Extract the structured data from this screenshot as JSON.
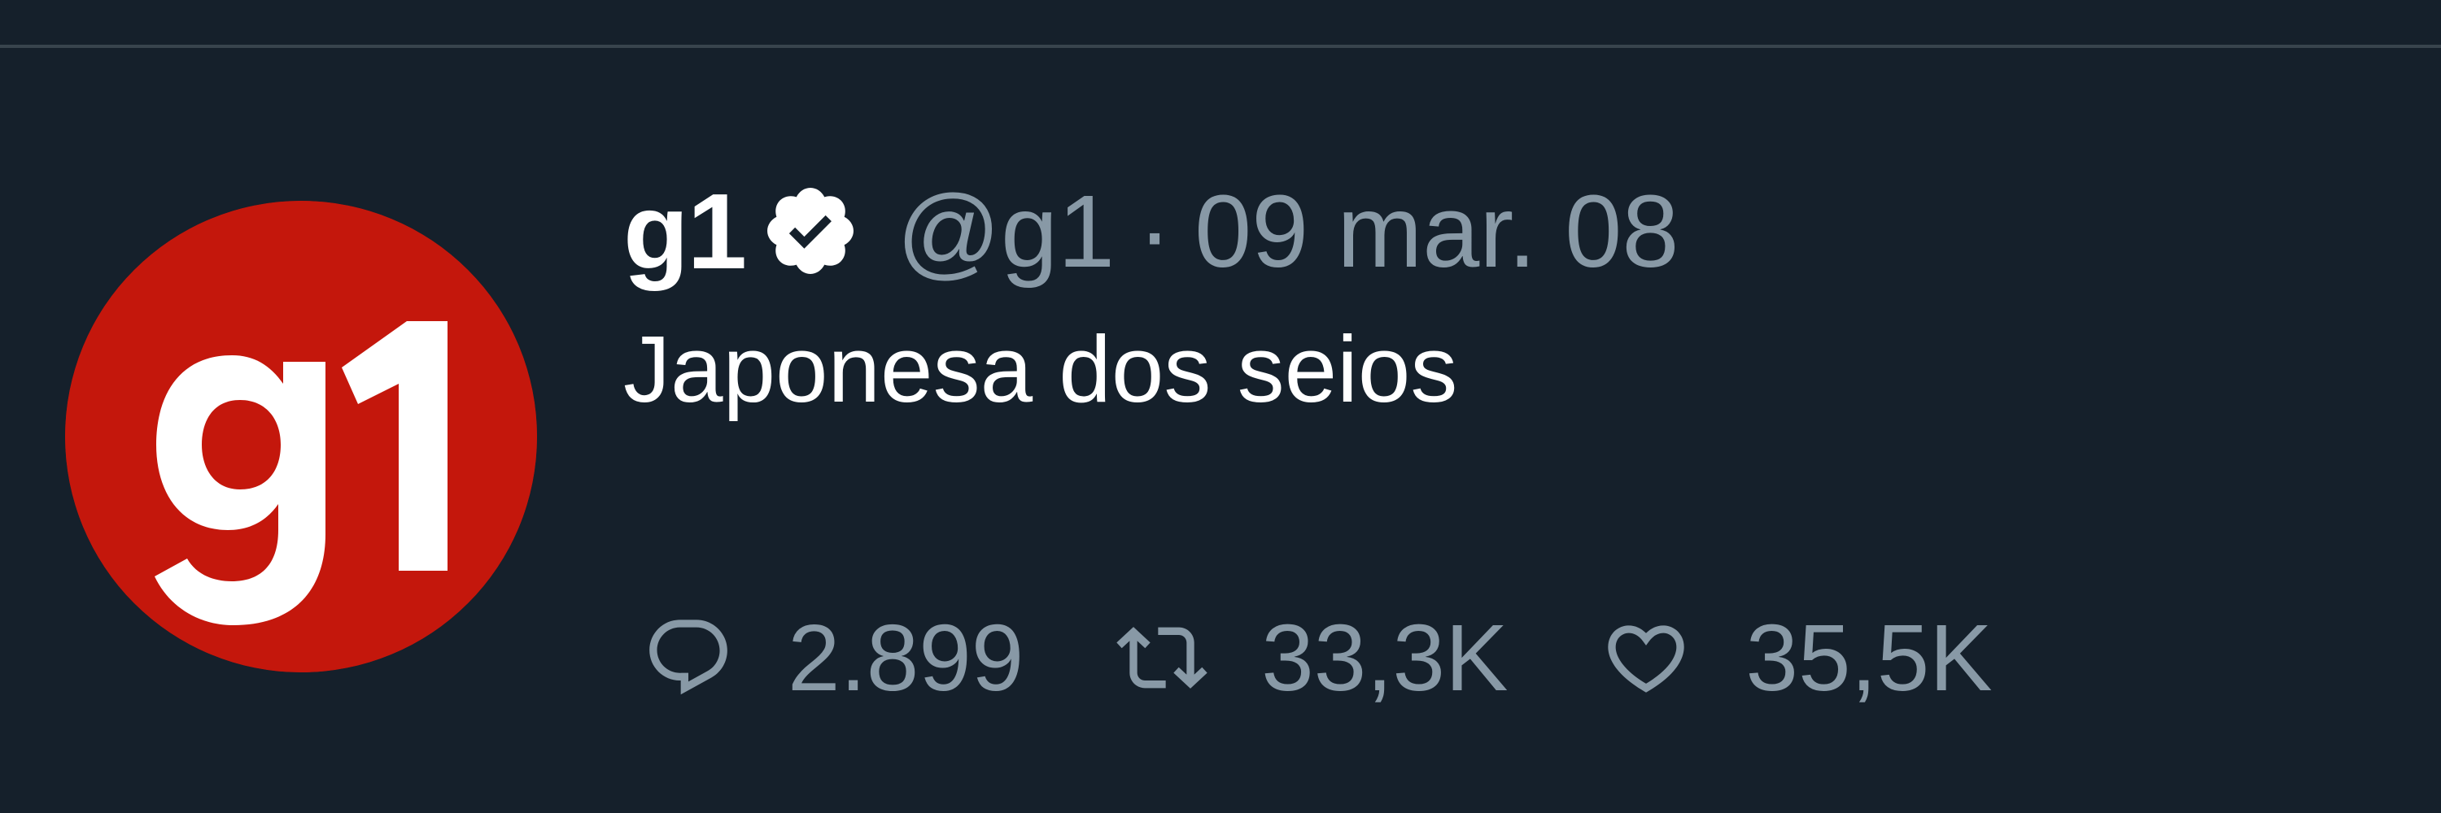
{
  "tweet": {
    "avatar_text": "g1",
    "display_name": "g1",
    "verified_icon": "verified-badge-icon",
    "handle": "@g1",
    "separator": "·",
    "date": "09 mar. 08",
    "text": "Japonesa dos seios",
    "actions": {
      "reply": {
        "icon": "reply-icon",
        "count": "2.899"
      },
      "retweet": {
        "icon": "retweet-icon",
        "count": "33,3K"
      },
      "like": {
        "icon": "heart-icon",
        "count": "35,5K"
      }
    }
  },
  "colors": {
    "background": "#15202b",
    "divider": "#38444d",
    "avatar_red": "#c4170c",
    "muted_text": "#8899a6",
    "primary_text": "#ffffff"
  }
}
